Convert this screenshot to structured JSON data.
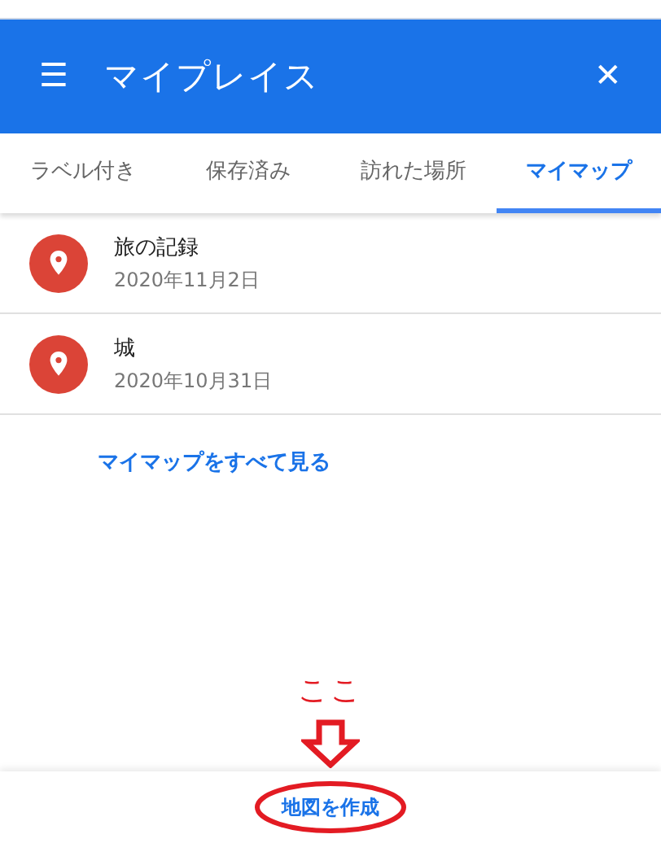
{
  "header": {
    "menu_icon": "☰",
    "title": "マイプレイス",
    "close_icon": "✕"
  },
  "tabs": [
    {
      "label": "ラベル付き",
      "selected": false
    },
    {
      "label": "保存済み",
      "selected": false
    },
    {
      "label": "訪れた場所",
      "selected": false
    },
    {
      "label": "マイマップ",
      "selected": true
    }
  ],
  "maps": [
    {
      "name": "旅の記録",
      "date": "2020年11月2日"
    },
    {
      "name": "城",
      "date": "2020年10月31日"
    }
  ],
  "see_all_link": "マイマップをすべて見る",
  "annotation": {
    "text": "ここ"
  },
  "create_map_button": {
    "label": "地図を作成",
    "circled": true
  }
}
